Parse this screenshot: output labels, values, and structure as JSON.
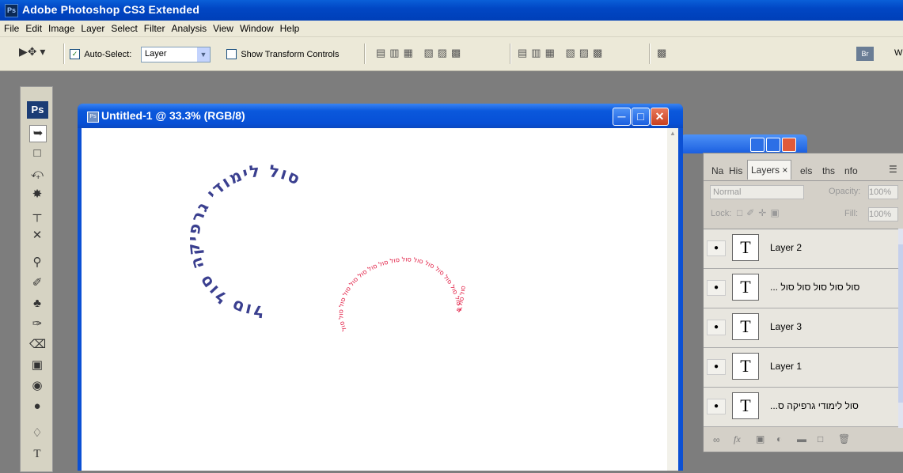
{
  "app": {
    "title": "Adobe Photoshop CS3 Extended",
    "ps_badge": "Ps"
  },
  "menu": [
    "File",
    "Edit",
    "Image",
    "Layer",
    "Select",
    "Filter",
    "Analysis",
    "View",
    "Window",
    "Help"
  ],
  "options": {
    "auto_select_label": "Auto-Select:",
    "auto_select_value": "Layer",
    "transform_label": "Show Transform Controls",
    "workspace_letter": "W"
  },
  "toolbox": {
    "logo": "Ps"
  },
  "document": {
    "title": "Untitled-1 @ 33.3% (RGB/8)",
    "circle_text": "סול לימודי גרפיקה סול סול",
    "shape_text": "סול סול סול סול סול סול סול סול סול סול סול סול סול סול סול סול סול סול סול",
    "circle_color": "#3a3f8f",
    "shape_color": "#e0143c"
  },
  "layers_panel": {
    "tabs": [
      "Na",
      "His",
      "Layers ×",
      "els",
      "ths",
      "nfo"
    ],
    "blend_mode": "Normal",
    "opacity_label": "Opacity:",
    "opacity_value": "100%",
    "lock_label": "Lock:",
    "fill_label": "Fill:",
    "fill_value": "100%",
    "layers": [
      {
        "name": "Layer 2",
        "type": "T"
      },
      {
        "name": "... סול סול סול סול סול",
        "type": "T"
      },
      {
        "name": "Layer 3",
        "type": "T"
      },
      {
        "name": "Layer 1",
        "type": "T"
      },
      {
        "name": "...סול לימודי גרפיקה ס",
        "type": "T"
      }
    ],
    "footer_fx": "fx"
  },
  "colors": {
    "titlebar": "#0147c4",
    "chrome": "#ece9d8",
    "workspace": "#7d7d7d"
  }
}
